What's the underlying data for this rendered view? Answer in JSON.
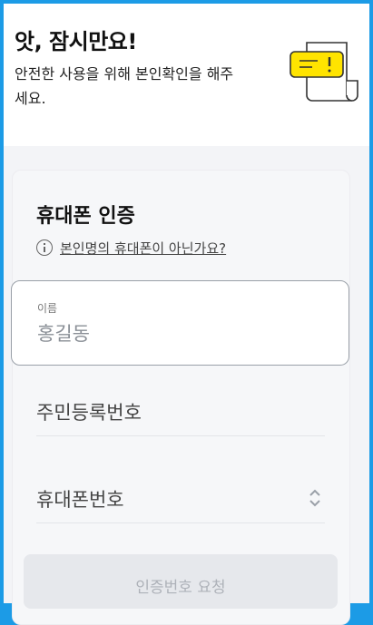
{
  "header": {
    "title": "앗, 잠시만요!",
    "subtitle": "안전한 사용을 위해 본인확인을 해주세요."
  },
  "card": {
    "title": "휴대폰 인증",
    "notice_link": "본인명의 휴대폰이 아닌가요?"
  },
  "form": {
    "name_label": "이름",
    "name_placeholder": "홍길동",
    "rrn_placeholder": "주민등록번호",
    "phone_placeholder": "휴대폰번호"
  },
  "actions": {
    "request_label": "인증번호 요청"
  },
  "colors": {
    "accent_yellow": "#ffe400",
    "frame_blue": "#1c9be6"
  }
}
